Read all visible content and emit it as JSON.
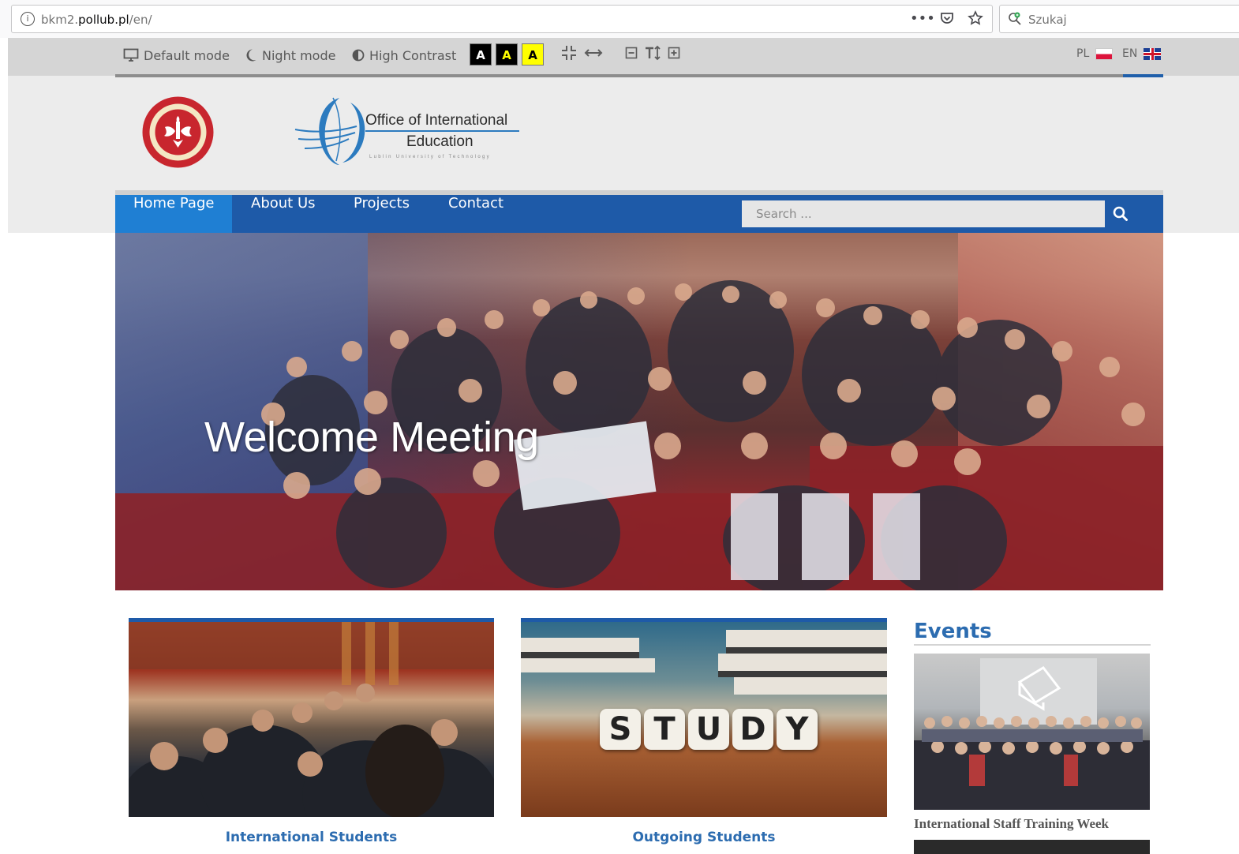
{
  "browser": {
    "url_prefix": "bkm2.",
    "url_host": "pollub.pl",
    "url_path": "/en/",
    "search_placeholder": "Szukaj"
  },
  "accessibility": {
    "default_mode": "Default mode",
    "night_mode": "Night mode",
    "high_contrast": "High Contrast",
    "contrast_options": [
      {
        "label": "A",
        "bg": "#000000",
        "fg": "#ffffff"
      },
      {
        "label": "A",
        "bg": "#000000",
        "fg": "#ffff00"
      },
      {
        "label": "A",
        "bg": "#ffff00",
        "fg": "#000000"
      }
    ],
    "languages": [
      {
        "code": "PL",
        "flag": "poland-flag-icon"
      },
      {
        "code": "EN",
        "flag": "uk-flag-icon"
      }
    ]
  },
  "branding": {
    "office_line1": "Office of International",
    "office_line2": "Education",
    "office_subtitle": "Lublin University of Technology"
  },
  "nav": {
    "items": [
      {
        "label": "Home Page",
        "active": true
      },
      {
        "label": "About Us"
      },
      {
        "label": "Projects"
      },
      {
        "label": "Contact"
      }
    ],
    "search_placeholder": "Search ..."
  },
  "hero": {
    "caption": "Welcome Meeting"
  },
  "cards": [
    {
      "caption": "International Students"
    },
    {
      "caption": "Outgoing Students",
      "image_text": [
        "S",
        "T",
        "U",
        "D",
        "Y"
      ]
    }
  ],
  "events": {
    "title": "Events",
    "items": [
      {
        "caption": "International Staff Training Week"
      }
    ]
  },
  "colors": {
    "brand_blue": "#1e5aa8",
    "active_tab": "#1f7fd3",
    "link_blue": "#2c6cb0"
  }
}
